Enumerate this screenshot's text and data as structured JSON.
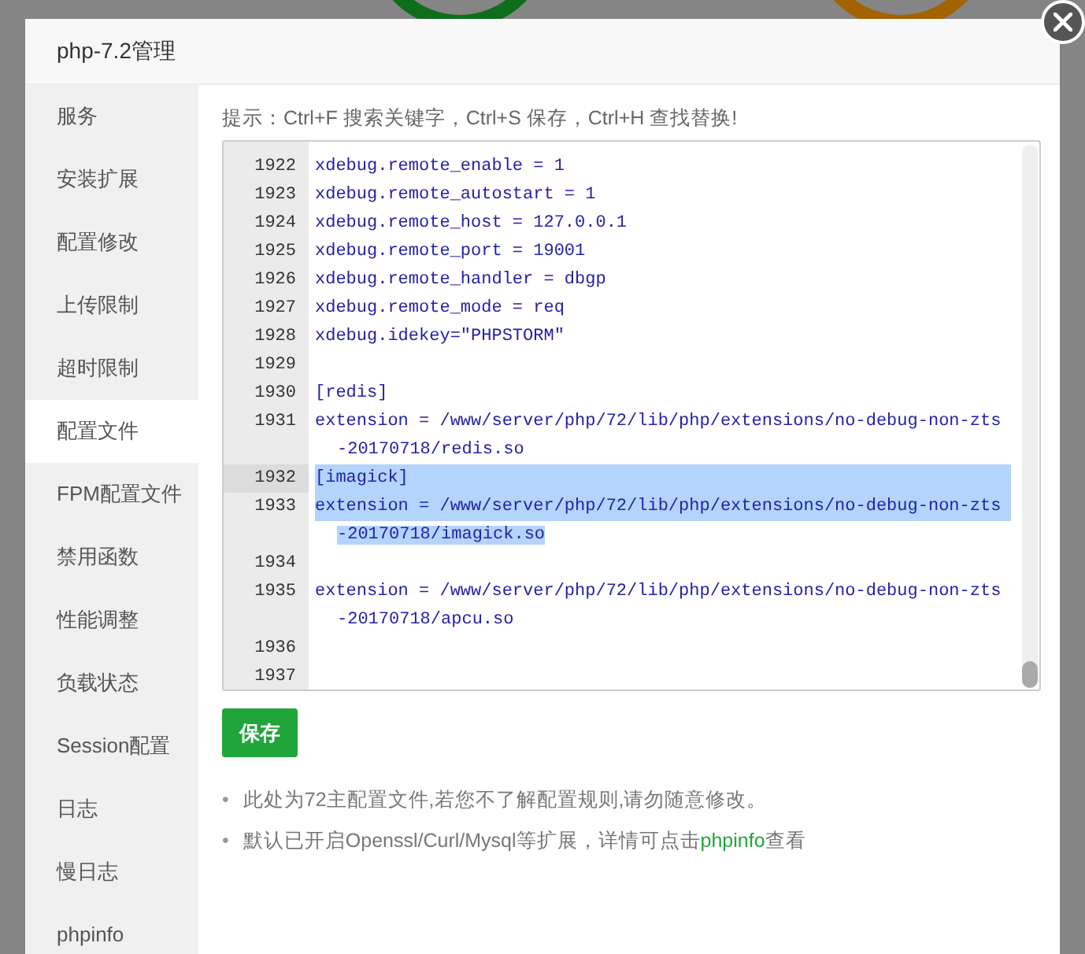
{
  "dialog": {
    "title": "php-7.2管理"
  },
  "sidebar": {
    "items": [
      {
        "label": "服务",
        "selected": false
      },
      {
        "label": "安装扩展",
        "selected": false
      },
      {
        "label": "配置修改",
        "selected": false
      },
      {
        "label": "上传限制",
        "selected": false
      },
      {
        "label": "超时限制",
        "selected": false
      },
      {
        "label": "配置文件",
        "selected": true
      },
      {
        "label": "FPM配置文件",
        "selected": false
      },
      {
        "label": "禁用函数",
        "selected": false
      },
      {
        "label": "性能调整",
        "selected": false
      },
      {
        "label": "负载状态",
        "selected": false
      },
      {
        "label": "Session配置",
        "selected": false
      },
      {
        "label": "日志",
        "selected": false
      },
      {
        "label": "慢日志",
        "selected": false
      },
      {
        "label": "phpinfo",
        "selected": false
      }
    ]
  },
  "hint": "提示：Ctrl+F 搜索关键字，Ctrl+S 保存，Ctrl+H 查找替换!",
  "editor": {
    "lines": [
      {
        "number": "1922",
        "rows": [
          "xdebug.remote_enable = 1"
        ],
        "selected": false,
        "active": false
      },
      {
        "number": "1923",
        "rows": [
          "xdebug.remote_autostart = 1"
        ],
        "selected": false,
        "active": false
      },
      {
        "number": "1924",
        "rows": [
          "xdebug.remote_host = 127.0.0.1"
        ],
        "selected": false,
        "active": false
      },
      {
        "number": "1925",
        "rows": [
          "xdebug.remote_port = 19001"
        ],
        "selected": false,
        "active": false
      },
      {
        "number": "1926",
        "rows": [
          "xdebug.remote_handler = dbgp"
        ],
        "selected": false,
        "active": false
      },
      {
        "number": "1927",
        "rows": [
          "xdebug.remote_mode = req"
        ],
        "selected": false,
        "active": false
      },
      {
        "number": "1928",
        "rows": [
          "xdebug.idekey=\"PHPSTORM\""
        ],
        "selected": false,
        "active": false
      },
      {
        "number": "1929",
        "selected": false,
        "active": false
      },
      {
        "number": "1930",
        "rows": [
          "[redis]"
        ],
        "selected": false,
        "active": false
      },
      {
        "number": "1931",
        "rows": [
          "extension = /www/server/php/72/lib/php/extensions/no-debug-non-zts",
          "-20170718/redis.so"
        ],
        "selected": false,
        "active": false
      },
      {
        "number": "1932",
        "rows": [
          "[imagick]"
        ],
        "selected": true,
        "active": true
      },
      {
        "number": "1933",
        "rows": [
          "extension = /www/server/php/72/lib/php/extensions/no-debug-non-zts",
          "-20170718/imagick.so"
        ],
        "selected": true,
        "active": false
      },
      {
        "number": "1934",
        "selected": false,
        "active": false
      },
      {
        "number": "1935",
        "rows": [
          "extension = /www/server/php/72/lib/php/extensions/no-debug-non-zts",
          "-20170718/apcu.so"
        ],
        "selected": false,
        "active": false
      },
      {
        "number": "1936",
        "selected": false,
        "active": false
      },
      {
        "number": "1937",
        "selected": false,
        "active": false
      }
    ]
  },
  "save_button": "保存",
  "notes": [
    {
      "bullet": "•",
      "text": "此处为72主配置文件,若您不了解配置规则,请勿随意修改。"
    },
    {
      "bullet": "•",
      "text": "默认已开启Openssl/Curl/Mysql等扩展，详情可点击",
      "link": "phpinfo",
      "after": "查看"
    }
  ]
}
